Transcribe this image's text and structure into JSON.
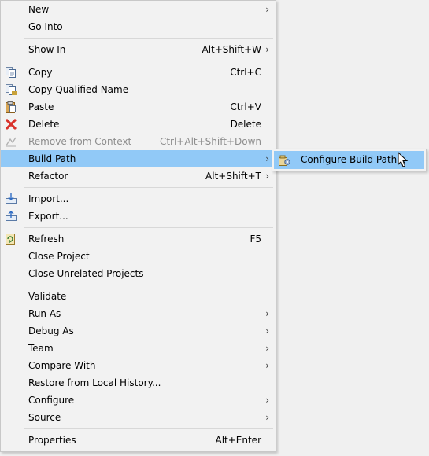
{
  "menu": {
    "items": [
      {
        "label": "New",
        "shortcut": "",
        "arrow": true
      },
      {
        "label": "Go Into",
        "shortcut": "",
        "arrow": false
      },
      {
        "label": "Show In",
        "shortcut": "Alt+Shift+W",
        "arrow": true
      },
      {
        "label": "Copy",
        "shortcut": "Ctrl+C",
        "arrow": false,
        "icon": "copy-icon"
      },
      {
        "label": "Copy Qualified Name",
        "shortcut": "",
        "arrow": false,
        "icon": "copy-qualified-name-icon"
      },
      {
        "label": "Paste",
        "shortcut": "Ctrl+V",
        "arrow": false,
        "icon": "paste-icon"
      },
      {
        "label": "Delete",
        "shortcut": "Delete",
        "arrow": false,
        "icon": "delete-icon"
      },
      {
        "label": "Remove from Context",
        "shortcut": "Ctrl+Alt+Shift+Down",
        "arrow": false,
        "icon": "remove-from-context-icon",
        "disabled": true
      },
      {
        "label": "Build Path",
        "shortcut": "",
        "arrow": true,
        "highlighted": true
      },
      {
        "label": "Refactor",
        "shortcut": "Alt+Shift+T",
        "arrow": true
      },
      {
        "label": "Import...",
        "shortcut": "",
        "arrow": false,
        "icon": "import-icon"
      },
      {
        "label": "Export...",
        "shortcut": "",
        "arrow": false,
        "icon": "export-icon"
      },
      {
        "label": "Refresh",
        "shortcut": "F5",
        "arrow": false,
        "icon": "refresh-icon"
      },
      {
        "label": "Close Project",
        "shortcut": "",
        "arrow": false
      },
      {
        "label": "Close Unrelated Projects",
        "shortcut": "",
        "arrow": false
      },
      {
        "label": "Validate",
        "shortcut": "",
        "arrow": false
      },
      {
        "label": "Run As",
        "shortcut": "",
        "arrow": true
      },
      {
        "label": "Debug As",
        "shortcut": "",
        "arrow": true
      },
      {
        "label": "Team",
        "shortcut": "",
        "arrow": true
      },
      {
        "label": "Compare With",
        "shortcut": "",
        "arrow": true
      },
      {
        "label": "Restore from Local History...",
        "shortcut": "",
        "arrow": false
      },
      {
        "label": "Configure",
        "shortcut": "",
        "arrow": true
      },
      {
        "label": "Source",
        "shortcut": "",
        "arrow": true
      },
      {
        "label": "Properties",
        "shortcut": "Alt+Enter",
        "arrow": false
      }
    ],
    "arrow_glyph": "›"
  },
  "submenu": {
    "items": [
      {
        "label": "Configure Build Path...",
        "icon": "configure-build-path-icon",
        "highlighted": true
      }
    ]
  },
  "colors": {
    "highlight": "#91c9f7",
    "menu_bg": "#f2f2f2",
    "disabled_text": "#8d8d8d",
    "delete_icon": "#d9322b"
  }
}
